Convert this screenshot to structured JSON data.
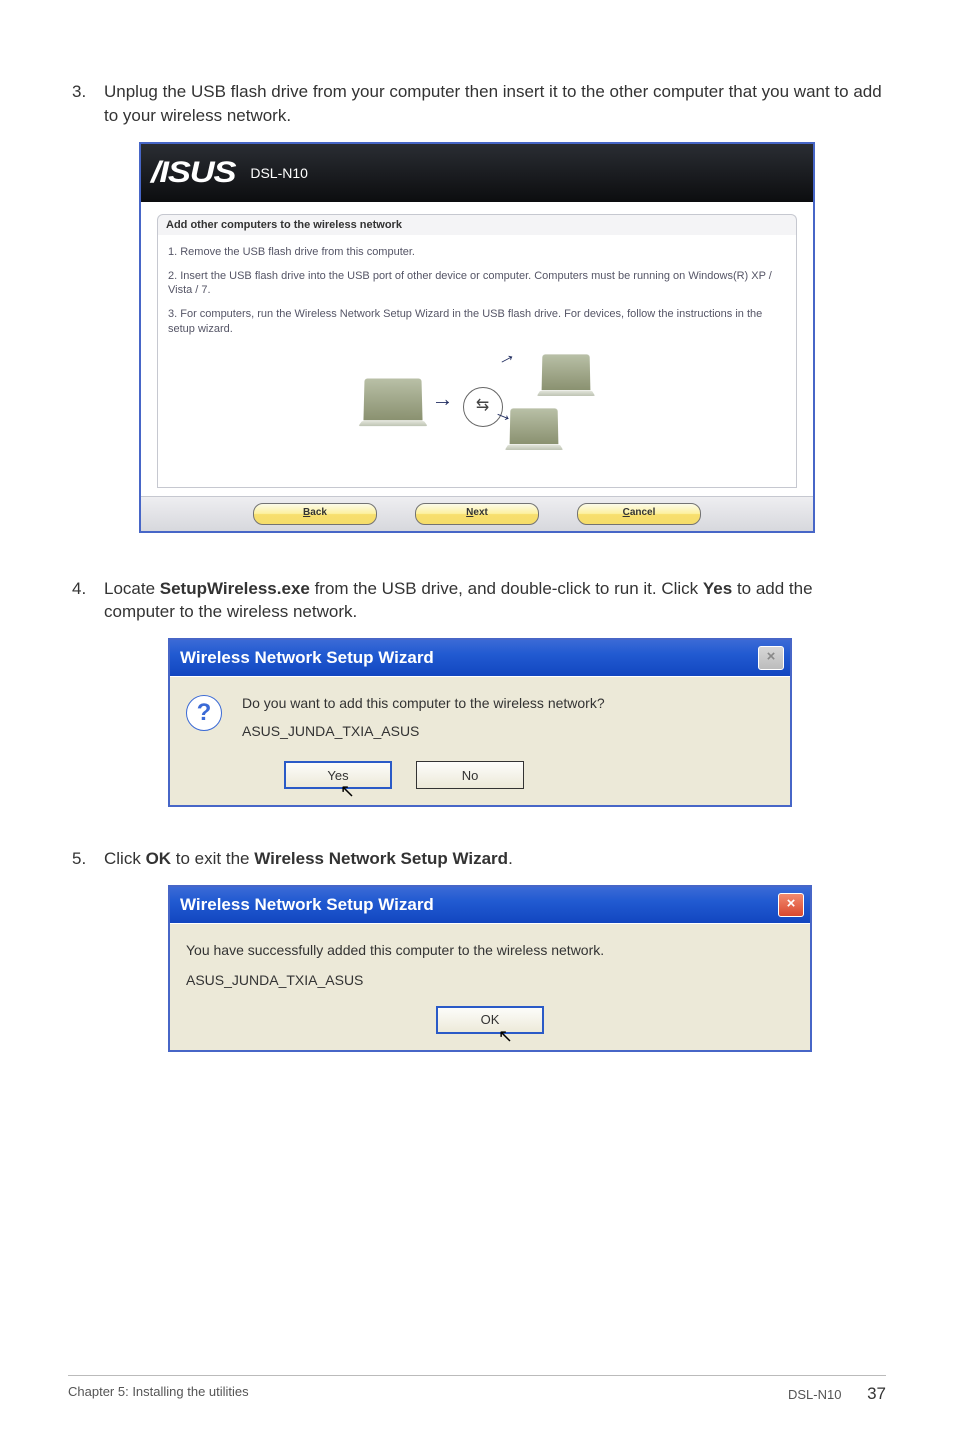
{
  "step3": {
    "num": "3.",
    "text": "Unplug the USB flash drive from your computer then insert it to the other computer that you want to add to your wireless network."
  },
  "step4": {
    "num": "4.",
    "prefix": "Locate ",
    "bold1": "SetupWireless.exe",
    "mid": " from the USB drive, and double-click to run it. Click ",
    "bold2": "Yes",
    "suffix": " to add the computer to the wireless network."
  },
  "step5": {
    "num": "5.",
    "prefix": "Click ",
    "bold1": "OK",
    "mid": " to exit the ",
    "bold2": "Wireless Network Setup Wizard",
    "suffix": "."
  },
  "shot1": {
    "model": "DSL-N10",
    "panel_title": "Add other computers to the wireless network",
    "line1": "1. Remove the USB flash drive from this computer.",
    "line2": "2. Insert the USB flash drive into the USB port of other device or computer. Computers must be running on Windows(R) XP / Vista / 7.",
    "line3": "3. For computers, run the Wireless Network Setup Wizard in the USB flash drive. For devices, follow the instructions in the setup wizard.",
    "back": "Back",
    "next": "Next",
    "cancel": "Cancel"
  },
  "shot2": {
    "title": "Wireless Network Setup Wizard",
    "question": "Do you want to add this computer to the wireless network?",
    "network": "ASUS_JUNDA_TXIA_ASUS",
    "yes": "Yes",
    "no": "No"
  },
  "shot3": {
    "title": "Wireless Network Setup Wizard",
    "message": "You have successfully added this computer to the wireless network.",
    "network": "ASUS_JUNDA_TXIA_ASUS",
    "ok": "OK"
  },
  "footer": {
    "left": "Chapter 5: Installing the utilities",
    "right": "DSL-N10",
    "page": "37"
  }
}
